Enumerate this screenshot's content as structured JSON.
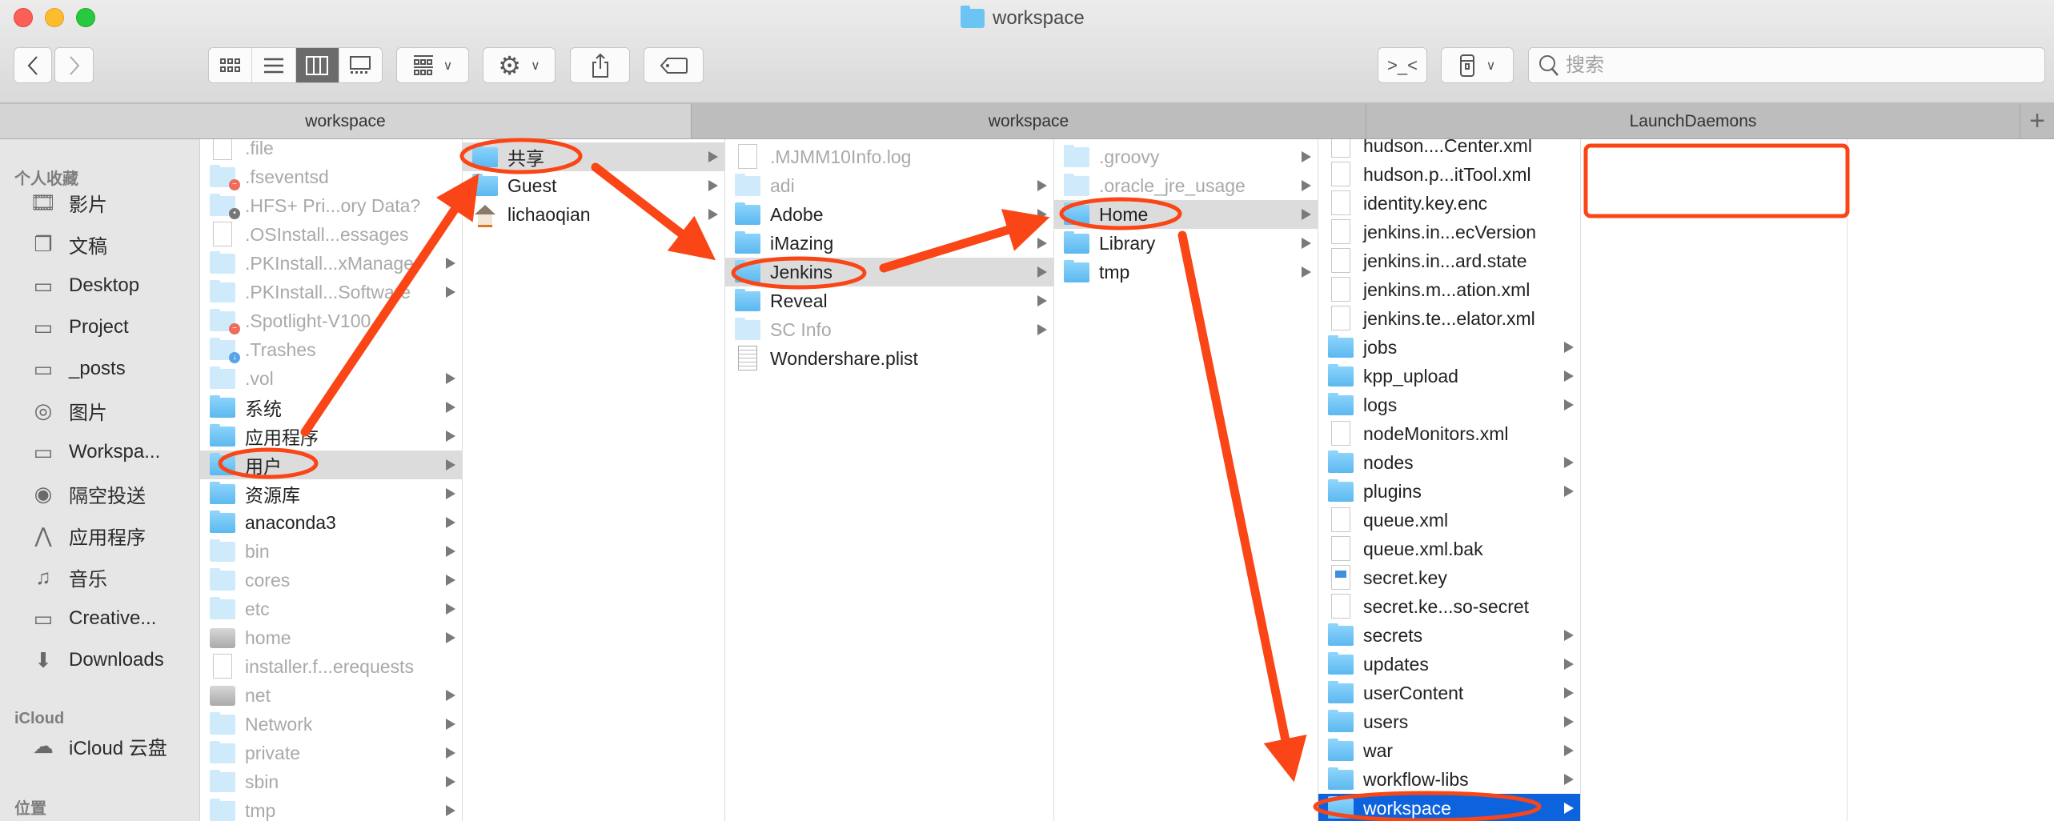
{
  "window": {
    "title": "workspace"
  },
  "toolbar": {
    "search_placeholder": "搜索",
    "view_modes": [
      "icon-view",
      "list-view",
      "column-view",
      "gallery-view"
    ],
    "selected_view": "column-view"
  },
  "tabs": [
    {
      "label": "workspace",
      "active": true
    },
    {
      "label": "workspace",
      "active": false
    },
    {
      "label": "LaunchDaemons",
      "active": false
    }
  ],
  "sidebar": {
    "sections": [
      {
        "title": "个人收藏",
        "items": [
          {
            "label": "影片",
            "icon": "film-icon"
          },
          {
            "label": "文稿",
            "icon": "documents-icon"
          },
          {
            "label": "Desktop",
            "icon": "desktop-icon"
          },
          {
            "label": "Project",
            "icon": "folder-icon"
          },
          {
            "label": "_posts",
            "icon": "folder-icon"
          },
          {
            "label": "图片",
            "icon": "camera-icon"
          },
          {
            "label": "Workspa...",
            "icon": "folder-icon"
          },
          {
            "label": "隔空投送",
            "icon": "airdrop-icon"
          },
          {
            "label": "应用程序",
            "icon": "applications-icon"
          },
          {
            "label": "音乐",
            "icon": "music-icon"
          },
          {
            "label": "Creative...",
            "icon": "folder-icon"
          },
          {
            "label": "Downloads",
            "icon": "downloads-icon"
          }
        ]
      },
      {
        "title": "iCloud",
        "items": [
          {
            "label": "iCloud 云盘",
            "icon": "cloud-icon"
          }
        ]
      },
      {
        "title": "位置",
        "items": []
      }
    ]
  },
  "columns": [
    {
      "items": [
        {
          "name": ".file",
          "icon": "file",
          "dim": true
        },
        {
          "name": ".fseventsd",
          "icon": "folder",
          "dim": true,
          "badge": "restricted"
        },
        {
          "name": ".HFS+ Pri...ory Data?",
          "icon": "folder",
          "dim": true,
          "badge": "locked"
        },
        {
          "name": ".OSInstall...essages",
          "icon": "file",
          "dim": true
        },
        {
          "name": ".PKInstall...xManager",
          "icon": "folder",
          "dim": true,
          "more": true
        },
        {
          "name": ".PKInstall...Software",
          "icon": "folder",
          "dim": true,
          "more": true
        },
        {
          "name": ".Spotlight-V100",
          "icon": "folder",
          "dim": true,
          "badge": "restricted"
        },
        {
          "name": ".Trashes",
          "icon": "folder",
          "dim": true,
          "badge": "download"
        },
        {
          "name": ".vol",
          "icon": "folder",
          "dim": true,
          "more": true
        },
        {
          "name": "系统",
          "icon": "folder",
          "more": true
        },
        {
          "name": "应用程序",
          "icon": "folder",
          "more": true
        },
        {
          "name": "用户",
          "icon": "folder",
          "more": true,
          "selected": true
        },
        {
          "name": "资源库",
          "icon": "folder",
          "more": true
        },
        {
          "name": "anaconda3",
          "icon": "folder",
          "more": true
        },
        {
          "name": "bin",
          "icon": "folder",
          "dim": true,
          "more": true
        },
        {
          "name": "cores",
          "icon": "folder",
          "dim": true,
          "more": true
        },
        {
          "name": "etc",
          "icon": "folder",
          "dim": true,
          "more": true
        },
        {
          "name": "home",
          "icon": "disk",
          "dim": true,
          "more": true
        },
        {
          "name": "installer.f...erequests",
          "icon": "file",
          "dim": true
        },
        {
          "name": "net",
          "icon": "disk",
          "dim": true,
          "more": true
        },
        {
          "name": "Network",
          "icon": "folder",
          "dim": true,
          "more": true
        },
        {
          "name": "private",
          "icon": "folder",
          "dim": true,
          "more": true
        },
        {
          "name": "sbin",
          "icon": "folder",
          "dim": true,
          "more": true
        },
        {
          "name": "tmp",
          "icon": "folder",
          "dim": true,
          "more": true
        }
      ]
    },
    {
      "items": [
        {
          "name": "共享",
          "icon": "folder",
          "more": true,
          "selected": true
        },
        {
          "name": "Guest",
          "icon": "folder",
          "more": true
        },
        {
          "name": "lichaoqian",
          "icon": "home",
          "more": true
        }
      ]
    },
    {
      "items": [
        {
          "name": ".MJMM10Info.log",
          "icon": "file",
          "dim": true
        },
        {
          "name": "adi",
          "icon": "folder",
          "dim": true,
          "more": true
        },
        {
          "name": "Adobe",
          "icon": "folder",
          "more": true
        },
        {
          "name": "iMazing",
          "icon": "folder",
          "more": true
        },
        {
          "name": "Jenkins",
          "icon": "folder",
          "more": true,
          "selected": true
        },
        {
          "name": "Reveal",
          "icon": "folder",
          "more": true
        },
        {
          "name": "SC Info",
          "icon": "folder",
          "dim": true,
          "more": true
        },
        {
          "name": "Wondershare.plist",
          "icon": "plist"
        }
      ]
    },
    {
      "items": [
        {
          "name": ".groovy",
          "icon": "folder",
          "dim": true,
          "more": true
        },
        {
          "name": ".oracle_jre_usage",
          "icon": "folder",
          "dim": true,
          "more": true
        },
        {
          "name": "Home",
          "icon": "folder",
          "more": true,
          "selected": true
        },
        {
          "name": "Library",
          "icon": "folder",
          "more": true
        },
        {
          "name": "tmp",
          "icon": "folder",
          "more": true
        }
      ]
    },
    {
      "items": [
        {
          "name": "hudson....Center.xml",
          "icon": "file"
        },
        {
          "name": "hudson.p...itTool.xml",
          "icon": "file"
        },
        {
          "name": "identity.key.enc",
          "icon": "file"
        },
        {
          "name": "jenkins.in...ecVersion",
          "icon": "file"
        },
        {
          "name": "jenkins.in...ard.state",
          "icon": "file"
        },
        {
          "name": "jenkins.m...ation.xml",
          "icon": "file"
        },
        {
          "name": "jenkins.te...elator.xml",
          "icon": "file"
        },
        {
          "name": "jobs",
          "icon": "folder",
          "more": true
        },
        {
          "name": "kpp_upload",
          "icon": "folder",
          "more": true
        },
        {
          "name": "logs",
          "icon": "folder",
          "more": true
        },
        {
          "name": "nodeMonitors.xml",
          "icon": "file"
        },
        {
          "name": "nodes",
          "icon": "folder",
          "more": true
        },
        {
          "name": "plugins",
          "icon": "folder",
          "more": true
        },
        {
          "name": "queue.xml",
          "icon": "file"
        },
        {
          "name": "queue.xml.bak",
          "icon": "file"
        },
        {
          "name": "secret.key",
          "icon": "key"
        },
        {
          "name": "secret.ke...so-secret",
          "icon": "file"
        },
        {
          "name": "secrets",
          "icon": "folder",
          "more": true
        },
        {
          "name": "updates",
          "icon": "folder",
          "more": true
        },
        {
          "name": "userContent",
          "icon": "folder",
          "more": true
        },
        {
          "name": "users",
          "icon": "folder",
          "more": true
        },
        {
          "name": "war",
          "icon": "folder",
          "more": true
        },
        {
          "name": "workflow-libs",
          "icon": "folder",
          "more": true
        },
        {
          "name": "workspace",
          "icon": "folder",
          "more": true,
          "active": true
        }
      ]
    },
    {
      "items": []
    }
  ],
  "colors": {
    "annotation": "#fa4616",
    "selection": "#0d63de",
    "folder": "#6cc4f5"
  }
}
